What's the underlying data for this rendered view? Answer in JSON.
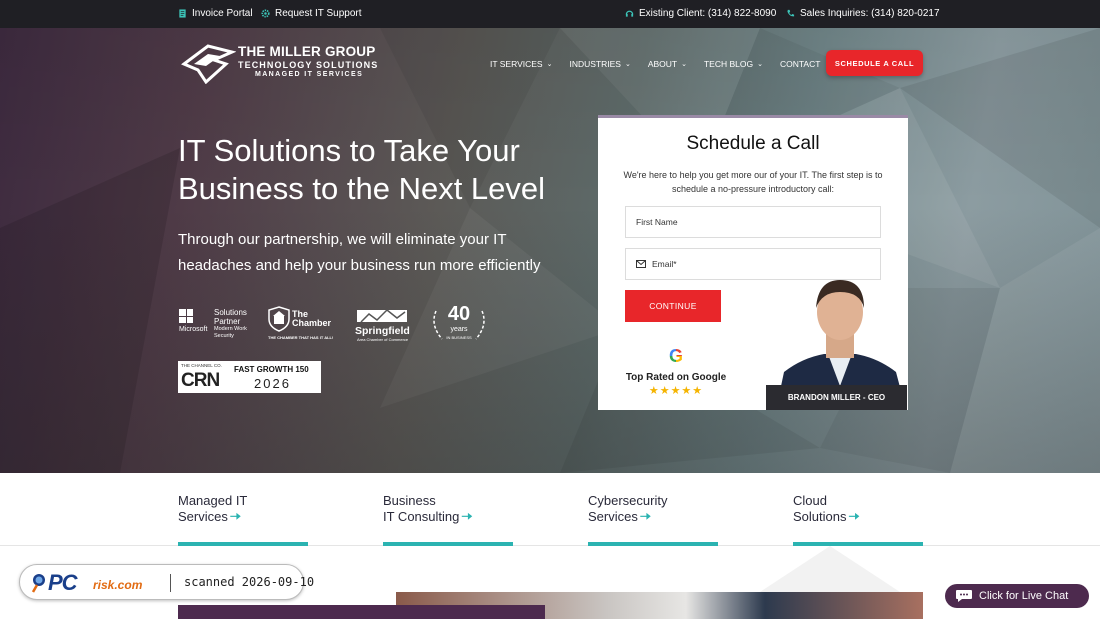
{
  "topbar": {
    "invoice": "Invoice Portal",
    "support": "Request IT Support",
    "existing": "Existing Client: (314) 822-8090",
    "sales": "Sales Inquiries: (314) 820-0217"
  },
  "logo": {
    "line1": "THE MILLER GROUP",
    "line2": "TECHNOLOGY SOLUTIONS",
    "line3": "MANAGED IT SERVICES"
  },
  "nav": {
    "items": [
      {
        "label": "IT SERVICES",
        "icon": "chevron-down-icon"
      },
      {
        "label": "INDUSTRIES",
        "icon": "chevron-down-icon"
      },
      {
        "label": "ABOUT",
        "icon": "chevron-down-icon"
      },
      {
        "label": "TECH BLOG",
        "icon": "chevron-down-icon"
      },
      {
        "label": "CONTACT"
      }
    ],
    "cta": "SCHEDULE A CALL"
  },
  "hero": {
    "title": "IT Solutions to Take Your Business to the Next Level",
    "subtitle": "Through our partnership, we will eliminate your IT headaches and help your business run more efficiently"
  },
  "badges": {
    "microsoft": {
      "word": "Microsoft",
      "l1": "Solutions",
      "l2": "Partner",
      "l3": "Modern Work",
      "l4": "Security"
    },
    "chamber": {
      "l1": "The",
      "l2": "Chamber",
      "tag": "THE CHAMBER THAT HAS IT ALL!"
    },
    "springfield": {
      "name": "Springfield",
      "tag": "Area Chamber of Commerce"
    },
    "years": {
      "num": "40",
      "word": "years",
      "sub": "IN BUSINESS"
    },
    "crn": {
      "channel": "THE CHANNEL CO.",
      "logo": "CRN",
      "title": "FAST GROWTH 150",
      "year": "2026"
    }
  },
  "form": {
    "title": "Schedule a Call",
    "text": "We're here to help you get more our of your IT. The first step is to schedule a no-pressure introductory call:",
    "first_name": "First Name",
    "email": "Email*",
    "button": "CONTINUE",
    "google_g": "G",
    "google_text": "Top Rated on Google",
    "stars": "★★★★★",
    "ceo": "BRANDON MILLER - CEO"
  },
  "services": [
    {
      "l1": "Managed IT",
      "l2": "Services"
    },
    {
      "l1": "Business",
      "l2": "IT Consulting"
    },
    {
      "l1": "Cybersecurity",
      "l2": "Services"
    },
    {
      "l1": "Cloud",
      "l2": "Solutions"
    }
  ],
  "overlay": {
    "pc": "PC",
    "risk": "risk.com",
    "scanned": "scanned 2026-09-10"
  },
  "livechat": {
    "label": "Click for Live Chat"
  },
  "colors": {
    "accent": "#e8262a",
    "teal": "#2bb3b1",
    "purple": "#4d2a4e",
    "dark": "#1f1f24"
  }
}
